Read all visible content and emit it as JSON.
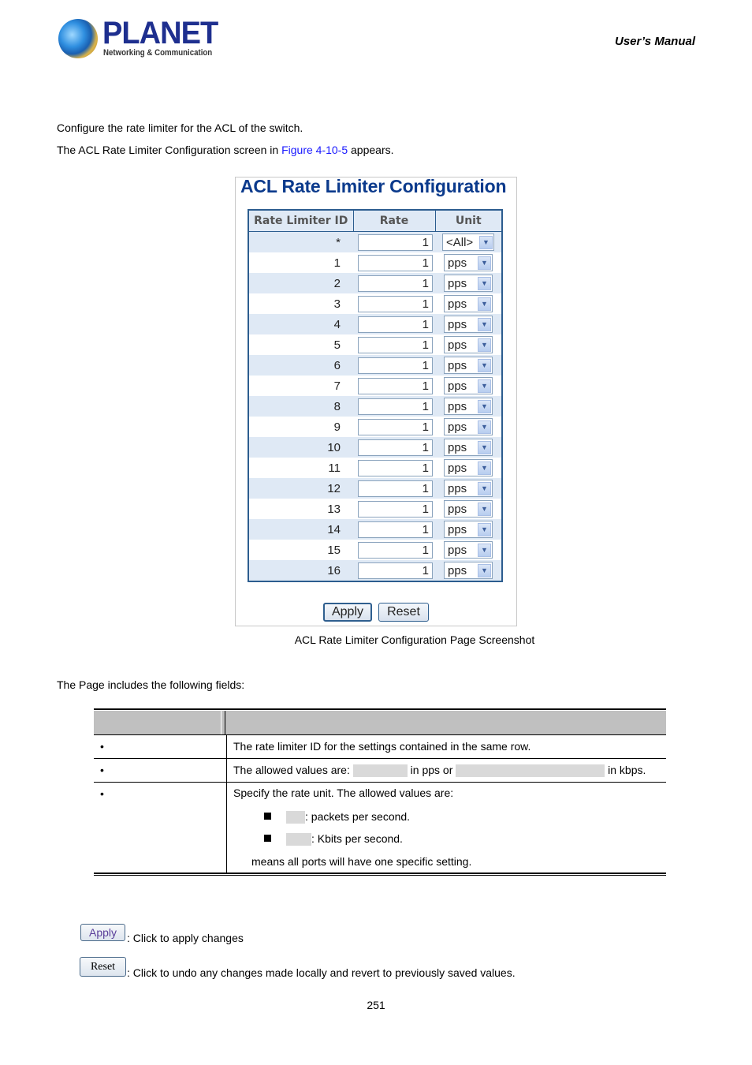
{
  "header": {
    "logo_name": "PLANET",
    "logo_tagline": "Networking & Communication",
    "manual_label": "User’s  Manual"
  },
  "intro": {
    "line1": "Configure the rate limiter for the ACL of the switch.",
    "line2_before": "The ACL Rate Limiter Configuration screen in ",
    "line2_link": "Figure 4-10-5",
    "line2_after": " appears."
  },
  "screenshot": {
    "title": "ACL Rate Limiter Configuration",
    "columns": [
      "Rate Limiter ID",
      "Rate",
      "Unit"
    ],
    "rows": [
      {
        "id": "*",
        "rate": "1",
        "unit": "<All>"
      },
      {
        "id": "1",
        "rate": "1",
        "unit": "pps"
      },
      {
        "id": "2",
        "rate": "1",
        "unit": "pps"
      },
      {
        "id": "3",
        "rate": "1",
        "unit": "pps"
      },
      {
        "id": "4",
        "rate": "1",
        "unit": "pps"
      },
      {
        "id": "5",
        "rate": "1",
        "unit": "pps"
      },
      {
        "id": "6",
        "rate": "1",
        "unit": "pps"
      },
      {
        "id": "7",
        "rate": "1",
        "unit": "pps"
      },
      {
        "id": "8",
        "rate": "1",
        "unit": "pps"
      },
      {
        "id": "9",
        "rate": "1",
        "unit": "pps"
      },
      {
        "id": "10",
        "rate": "1",
        "unit": "pps"
      },
      {
        "id": "11",
        "rate": "1",
        "unit": "pps"
      },
      {
        "id": "12",
        "rate": "1",
        "unit": "pps"
      },
      {
        "id": "13",
        "rate": "1",
        "unit": "pps"
      },
      {
        "id": "14",
        "rate": "1",
        "unit": "pps"
      },
      {
        "id": "15",
        "rate": "1",
        "unit": "pps"
      },
      {
        "id": "16",
        "rate": "1",
        "unit": "pps"
      }
    ],
    "apply_label": "Apply",
    "reset_label": "Reset",
    "caption": "ACL Rate Limiter Configuration Page Screenshot"
  },
  "fields_intro": "The Page includes the following fields:",
  "fields": {
    "row1_desc": "The rate limiter ID for the settings contained in the same row.",
    "row2_desc_a": "The allowed values are: ",
    "row2_desc_b": " in pps or ",
    "row2_desc_c": " in kbps.",
    "row3_desc": "Specify the rate unit. The allowed values are:",
    "row3_item1": ": packets per second.",
    "row3_item2": ": Kbits per second.",
    "row3_note": "means all ports will have one specific setting.",
    "bullet": "•"
  },
  "buttons_help": {
    "apply_label": "Apply",
    "apply_desc": ": Click to apply changes",
    "reset_label": "Reset",
    "reset_desc": ": Click to undo any changes made locally and revert to previously saved values."
  },
  "page_number": "251"
}
